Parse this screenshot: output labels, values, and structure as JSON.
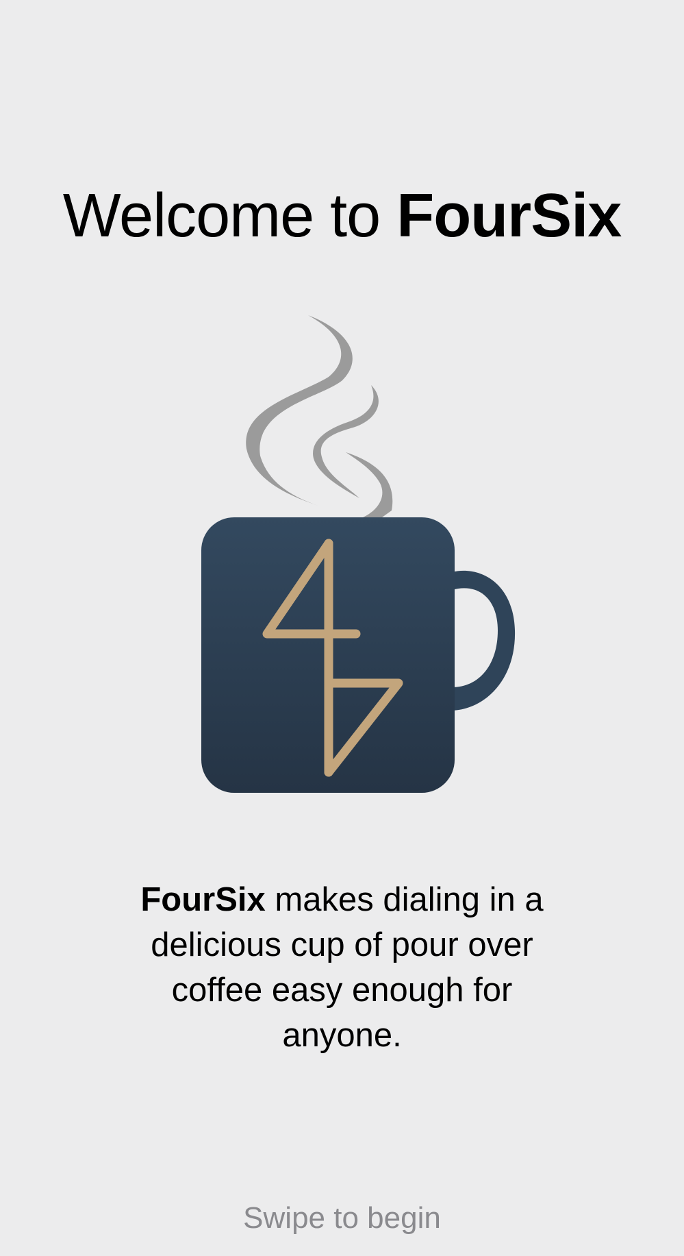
{
  "welcome": {
    "title_prefix": "Welcome to ",
    "title_brand": "FourSix"
  },
  "logo": {
    "icon": "coffee-mug-icon",
    "steam_color": "#9b9b9b",
    "mug_color_top": "#33495f",
    "mug_color_bottom": "#253445",
    "glyph_color": "#c3a57c"
  },
  "description": {
    "brand": "FourSix",
    "text": " makes dialing in a delicious cup of pour over coffee easy enough for anyone."
  },
  "footer": {
    "hint": "Swipe to begin"
  }
}
